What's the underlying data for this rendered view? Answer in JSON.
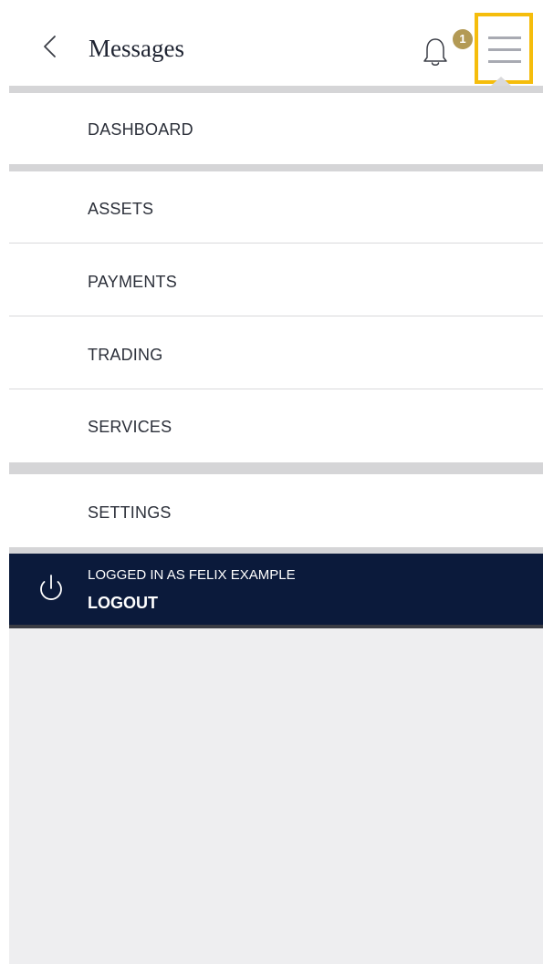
{
  "header": {
    "title": "Messages",
    "back_icon": "chevron-left-icon",
    "bell_icon": "bell-icon",
    "notification_count": "1",
    "menu_icon": "hamburger-menu-icon"
  },
  "menu": {
    "items": [
      {
        "label": "DASHBOARD"
      },
      {
        "label": "ASSETS"
      },
      {
        "label": "PAYMENTS"
      },
      {
        "label": "TRADING"
      },
      {
        "label": "SERVICES"
      },
      {
        "label": "SETTINGS"
      }
    ]
  },
  "footer": {
    "logged_in_text": "LOGGED IN AS FELIX EXAMPLE",
    "logout_label": "LOGOUT",
    "power_icon": "power-icon"
  },
  "colors": {
    "accent_highlight": "#f5bd0c",
    "badge": "#b39a55",
    "footer_bg": "#0b1a3b",
    "page_bg": "#eeeef0"
  }
}
